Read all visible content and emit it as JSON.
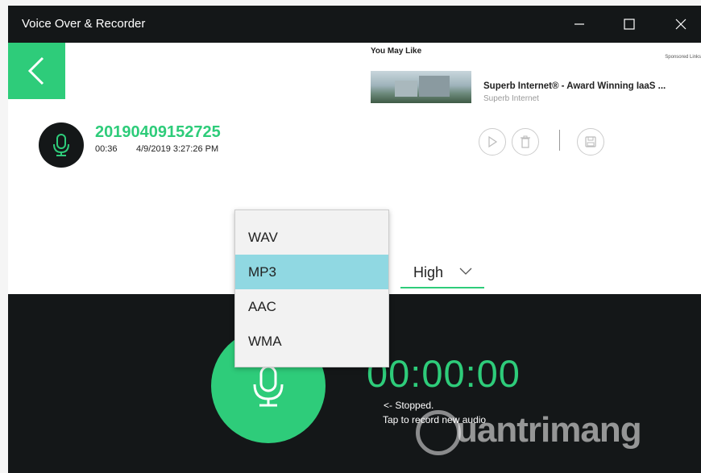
{
  "window": {
    "title": "Voice Over & Recorder"
  },
  "ad": {
    "label": "You May Like",
    "sponsored": "Sponsored Links",
    "title": "Superb Internet® - Award Winning IaaS ...",
    "source": "Superb Internet"
  },
  "recording": {
    "name": "20190409152725",
    "duration": "00:36",
    "date": "4/9/2019 3:27:26 PM"
  },
  "quality": {
    "value": "High"
  },
  "format_menu": {
    "items": [
      "WAV",
      "MP3",
      "AAC",
      "WMA"
    ],
    "selected": "MP3"
  },
  "recorder": {
    "timer": "00:00:00",
    "status": "<- Stopped.",
    "hint": "Tap to record new audio"
  },
  "watermark": {
    "text": "uantrimang"
  },
  "colors": {
    "accent": "#2ecc7a",
    "dark": "#141718",
    "selection": "#90d8e2"
  }
}
